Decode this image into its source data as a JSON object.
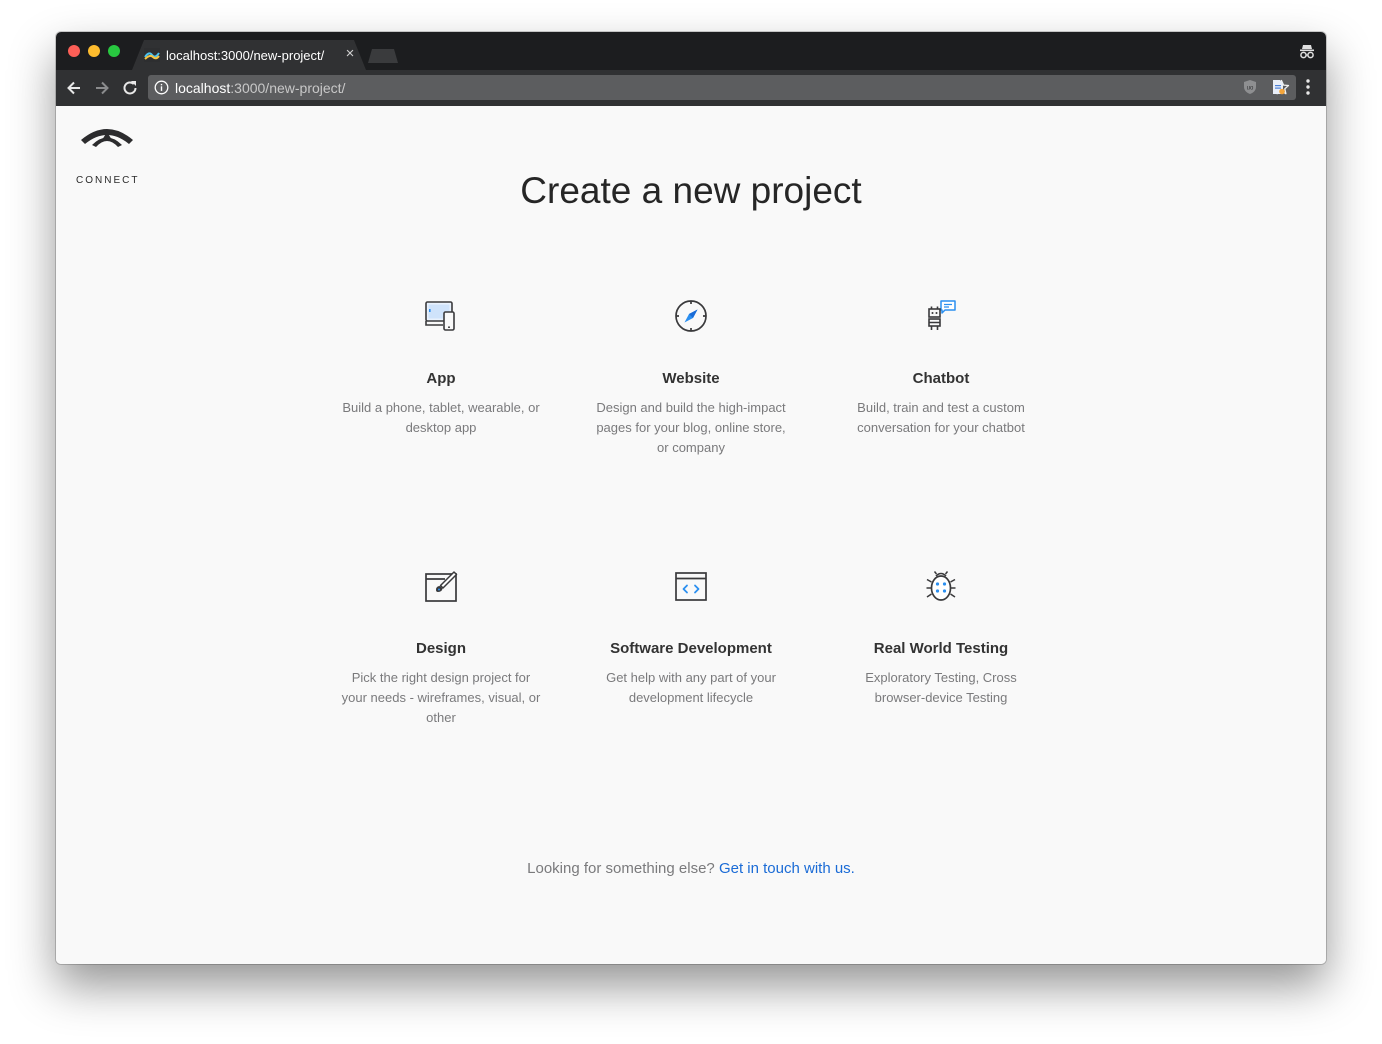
{
  "browser": {
    "tab_title": "localhost:3000/new-project/",
    "tab_close": "×",
    "url_host": "localhost",
    "url_path": ":3000/new-project/"
  },
  "logo": {
    "text": "CONNECT"
  },
  "page": {
    "title": "Create a new project",
    "cards": [
      {
        "title": "App",
        "description": "Build a phone, tablet, wearable, or desktop app",
        "icon": "devices-icon"
      },
      {
        "title": "Website",
        "description": "Design and build the high-impact pages for your blog, online store, or company",
        "icon": "compass-icon"
      },
      {
        "title": "Chatbot",
        "description": "Build, train and test a custom conversation for your chatbot",
        "icon": "chatbot-icon"
      },
      {
        "title": "Design",
        "description": "Pick the right design project for your needs - wireframes, visual, or other",
        "icon": "design-icon"
      },
      {
        "title": "Software Development",
        "description": "Get help with any part of your development lifecycle",
        "icon": "code-window-icon"
      },
      {
        "title": "Real World Testing",
        "description": "Exploratory Testing, Cross browser-device Testing",
        "icon": "bug-icon"
      }
    ],
    "footer_prefix": "Looking for something else?",
    "footer_link": "Get in touch with us."
  },
  "colors": {
    "accent": "#1a6bd6",
    "icon_dark": "#3a3a3c",
    "icon_blue": "#2b8ff0",
    "page_bg": "#f9f9f9",
    "chrome_dark": "#1c1d1f"
  }
}
